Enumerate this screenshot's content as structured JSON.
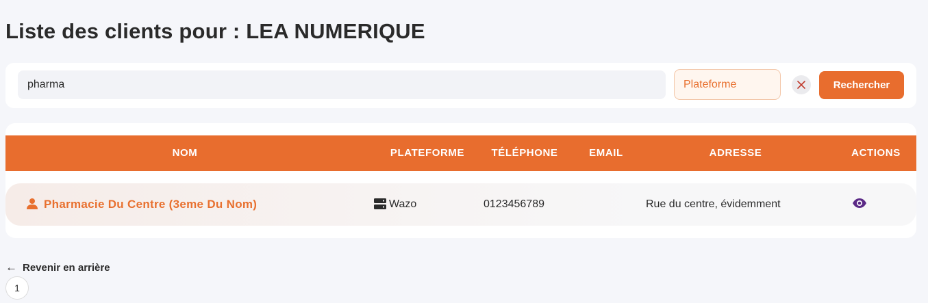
{
  "page": {
    "title": "Liste des clients pour : LEA NUMERIQUE"
  },
  "search": {
    "value": "pharma",
    "platform_placeholder": "Plateforme",
    "submit_label": "Rechercher",
    "clear_icon": "close-icon"
  },
  "table": {
    "headers": {
      "name": "NOM",
      "platform": "PLATEFORME",
      "phone": "TÉLÉPHONE",
      "email": "EMAIL",
      "address": "ADRESSE",
      "actions": "ACTIONS"
    },
    "rows": [
      {
        "name": "Pharmacie Du Centre (3eme Du Nom)",
        "platform": "Wazo",
        "phone": "0123456789",
        "email": "",
        "address": "Rue du centre, évidemment",
        "icons": {
          "name": "person-icon",
          "platform": "server-icon",
          "action": "eye-icon"
        }
      }
    ]
  },
  "navigation": {
    "back_label": "Revenir en arrière"
  },
  "pagination": {
    "pages": [
      "1"
    ]
  },
  "colors": {
    "accent": "#e86d2e",
    "action_icon": "#5b2a86",
    "background": "#f5f6fa"
  }
}
